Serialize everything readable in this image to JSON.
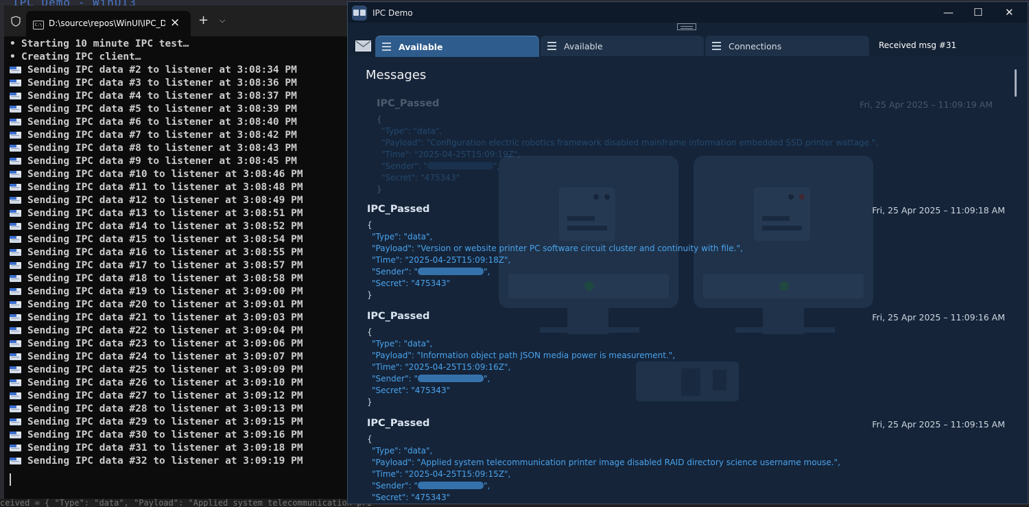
{
  "backdrop": {
    "title": "IPC Demo - WinUI3",
    "bottom_text": "ceived = { \"Type\": \"data\", \"Payload\": \"Applied system telecommunication pri"
  },
  "terminal": {
    "tab_title": "D:\\source\\repos\\WinUI\\IPC_Demo",
    "tab_icon_text": "C:\\",
    "new_tab": "+",
    "close_tab": "×",
    "dropdown": "⌄",
    "lines": [
      {
        "icon": "bullet",
        "text": "Starting 10 minute IPC test…"
      },
      {
        "icon": "bullet",
        "text": "Creating IPC client…"
      },
      {
        "icon": "envelope",
        "text": "Sending IPC data #2 to listener at 3:08:34 PM"
      },
      {
        "icon": "envelope",
        "text": "Sending IPC data #3 to listener at 3:08:36 PM"
      },
      {
        "icon": "envelope",
        "text": "Sending IPC data #4 to listener at 3:08:37 PM"
      },
      {
        "icon": "envelope",
        "text": "Sending IPC data #5 to listener at 3:08:39 PM"
      },
      {
        "icon": "envelope",
        "text": "Sending IPC data #6 to listener at 3:08:40 PM"
      },
      {
        "icon": "envelope",
        "text": "Sending IPC data #7 to listener at 3:08:42 PM"
      },
      {
        "icon": "envelope",
        "text": "Sending IPC data #8 to listener at 3:08:43 PM"
      },
      {
        "icon": "envelope",
        "text": "Sending IPC data #9 to listener at 3:08:45 PM"
      },
      {
        "icon": "envelope",
        "text": "Sending IPC data #10 to listener at 3:08:46 PM"
      },
      {
        "icon": "envelope",
        "text": "Sending IPC data #11 to listener at 3:08:48 PM"
      },
      {
        "icon": "envelope",
        "text": "Sending IPC data #12 to listener at 3:08:49 PM"
      },
      {
        "icon": "envelope",
        "text": "Sending IPC data #13 to listener at 3:08:51 PM"
      },
      {
        "icon": "envelope",
        "text": "Sending IPC data #14 to listener at 3:08:52 PM"
      },
      {
        "icon": "envelope",
        "text": "Sending IPC data #15 to listener at 3:08:54 PM"
      },
      {
        "icon": "envelope",
        "text": "Sending IPC data #16 to listener at 3:08:55 PM"
      },
      {
        "icon": "envelope",
        "text": "Sending IPC data #17 to listener at 3:08:57 PM"
      },
      {
        "icon": "envelope",
        "text": "Sending IPC data #18 to listener at 3:08:58 PM"
      },
      {
        "icon": "envelope",
        "text": "Sending IPC data #19 to listener at 3:09:00 PM"
      },
      {
        "icon": "envelope",
        "text": "Sending IPC data #20 to listener at 3:09:01 PM"
      },
      {
        "icon": "envelope",
        "text": "Sending IPC data #21 to listener at 3:09:03 PM"
      },
      {
        "icon": "envelope",
        "text": "Sending IPC data #22 to listener at 3:09:04 PM"
      },
      {
        "icon": "envelope",
        "text": "Sending IPC data #23 to listener at 3:09:06 PM"
      },
      {
        "icon": "envelope",
        "text": "Sending IPC data #24 to listener at 3:09:07 PM"
      },
      {
        "icon": "envelope",
        "text": "Sending IPC data #25 to listener at 3:09:09 PM"
      },
      {
        "icon": "envelope",
        "text": "Sending IPC data #26 to listener at 3:09:10 PM"
      },
      {
        "icon": "envelope",
        "text": "Sending IPC data #27 to listener at 3:09:12 PM"
      },
      {
        "icon": "envelope",
        "text": "Sending IPC data #28 to listener at 3:09:13 PM"
      },
      {
        "icon": "envelope",
        "text": "Sending IPC data #29 to listener at 3:09:15 PM"
      },
      {
        "icon": "envelope",
        "text": "Sending IPC data #30 to listener at 3:09:16 PM"
      },
      {
        "icon": "envelope",
        "text": "Sending IPC data #31 to listener at 3:09:18 PM"
      },
      {
        "icon": "envelope",
        "text": "Sending IPC data #32 to listener at 3:09:19 PM"
      }
    ]
  },
  "ipc_window": {
    "title": "IPC Demo",
    "window_controls": {
      "minimize": "—",
      "maximize": "☐",
      "close": "✕"
    },
    "tabs": [
      {
        "label": "Available",
        "active": true
      },
      {
        "label": "Available",
        "active": false
      },
      {
        "label": "Connections",
        "active": false
      }
    ],
    "status": "Received msg #31",
    "heading": "Messages",
    "messages": [
      {
        "title": "IPC_Passed",
        "timestamp": "Fri, 25 Apr 2025 – 11:09:19 AM",
        "faded": true,
        "open": "{",
        "type_line": "\"Type\": \"data\",",
        "payload_line": "\"Payload\": \"Configuration electric robotics framework disabled mainframe information embedded SSD printer wattage.\",",
        "time_line": "\"Time\": \"2025-04-25T15:09:19Z\",",
        "sender_key": "\"Sender\": \"",
        "sender_tail": "\",",
        "secret_line": "\"Secret\": \"475343\"",
        "close": "}"
      },
      {
        "title": "IPC_Passed",
        "timestamp": "Fri, 25 Apr 2025 – 11:09:18 AM",
        "faded": false,
        "open": "{",
        "type_line": "\"Type\": \"data\",",
        "payload_line": "\"Payload\": \"Version or website printer PC software circuit cluster and continuity with file.\",",
        "time_line": "\"Time\": \"2025-04-25T15:09:18Z\",",
        "sender_key": "\"Sender\": \"",
        "sender_tail": "\",",
        "secret_line": "\"Secret\": \"475343\"",
        "close": "}"
      },
      {
        "title": "IPC_Passed",
        "timestamp": "Fri, 25 Apr 2025 – 11:09:16 AM",
        "faded": false,
        "open": "{",
        "type_line": "\"Type\": \"data\",",
        "payload_line": "\"Payload\": \"Information object path JSON media power is measurement.\",",
        "time_line": "\"Time\": \"2025-04-25T15:09:16Z\",",
        "sender_key": "\"Sender\": \"",
        "sender_tail": "\",",
        "secret_line": "\"Secret\": \"475343\"",
        "close": "}"
      },
      {
        "title": "IPC_Passed",
        "timestamp": "Fri, 25 Apr 2025 – 11:09:15 AM",
        "faded": false,
        "open": "{",
        "type_line": "\"Type\": \"data\",",
        "payload_line": "\"Payload\": \"Applied system telecommunication printer image disabled RAID directory science username mouse.\",",
        "time_line": "\"Time\": \"2025-04-25T15:09:15Z\",",
        "sender_key": "\"Sender\": \"",
        "sender_tail": "\",",
        "secret_line": "\"Secret\": \"475343\"",
        "close": "}"
      }
    ]
  },
  "colors": {
    "terminal_bg": "#0c0c0c",
    "terminal_text": "#cccccc",
    "window_bg": "#152439",
    "active_tab": "#2e5c8c",
    "json_value": "#4aa3ec"
  }
}
